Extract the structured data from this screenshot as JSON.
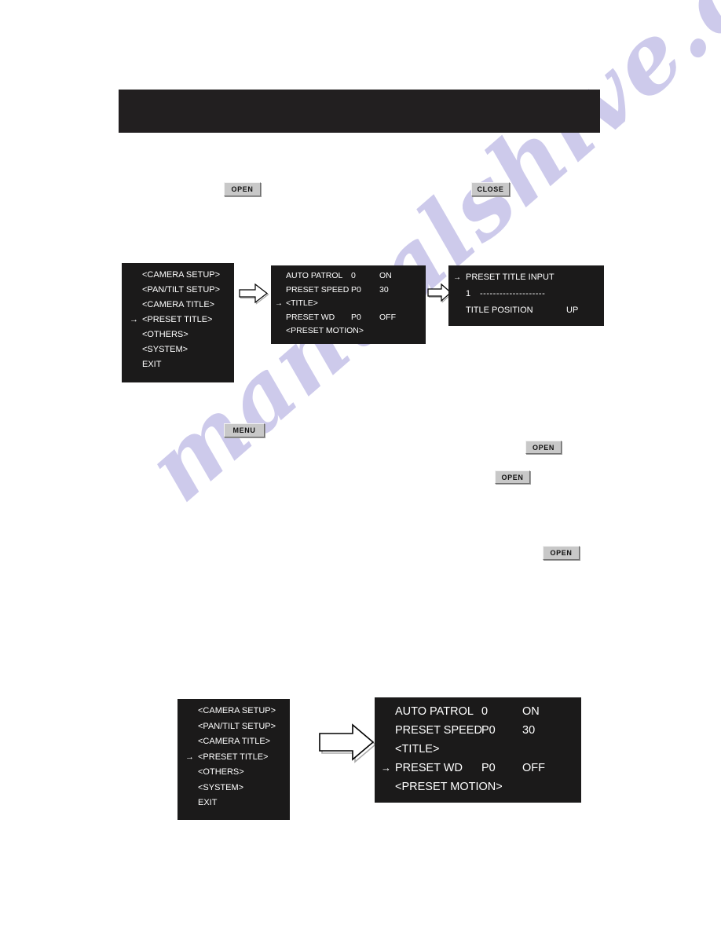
{
  "page": {
    "header_bar_text": "",
    "watermark": "manualshive.com"
  },
  "buttons": {
    "open": "OPEN",
    "close": "CLOSE",
    "menu": "MENU"
  },
  "icons": {
    "flow_arrow": "right-block-arrow-icon",
    "cursor": "→"
  },
  "menu_top": {
    "cursor_index": 3,
    "items": [
      {
        "label": "<CAMERA SETUP>"
      },
      {
        "label": "<PAN/TILT SETUP>"
      },
      {
        "label": "<CAMERA TITLE>"
      },
      {
        "label": "<PRESET TITLE>"
      },
      {
        "label": "<OTHERS>"
      },
      {
        "label": "<SYSTEM>"
      },
      {
        "label": "EXIT"
      }
    ]
  },
  "preset_top": {
    "cursor_index": 2,
    "rows": [
      {
        "label": "AUTO PATROL",
        "value1": "0",
        "value2": "ON"
      },
      {
        "label": "PRESET SPEED",
        "value1": "P0",
        "value2": "30"
      },
      {
        "label": "<TITLE>",
        "value1": "",
        "value2": ""
      },
      {
        "label": "PRESET WD",
        "value1": "P0",
        "value2": "OFF"
      },
      {
        "label": "<PRESET MOTION>",
        "value1": "",
        "value2": ""
      }
    ]
  },
  "title_input": {
    "cursor_index": 0,
    "heading": "PRESET TITLE INPUT",
    "entry_number": "1",
    "entry_dashes": "--------------------",
    "position_label": "TITLE POSITION",
    "position_value": "UP"
  },
  "menu_bottom": {
    "cursor_index": 3,
    "items": [
      {
        "label": "<CAMERA SETUP>"
      },
      {
        "label": "<PAN/TILT SETUP>"
      },
      {
        "label": "<CAMERA TITLE>"
      },
      {
        "label": "<PRESET TITLE>"
      },
      {
        "label": "<OTHERS>"
      },
      {
        "label": "<SYSTEM>"
      },
      {
        "label": "EXIT"
      }
    ]
  },
  "preset_bottom": {
    "cursor_index": 3,
    "rows": [
      {
        "label": "AUTO PATROL",
        "value1": "0",
        "value2": "ON"
      },
      {
        "label": "PRESET SPEED",
        "value1": "P0",
        "value2": "30"
      },
      {
        "label": "<TITLE>",
        "value1": "",
        "value2": ""
      },
      {
        "label": "PRESET WD",
        "value1": "P0",
        "value2": "OFF"
      },
      {
        "label": "<PRESET MOTION>",
        "value1": "",
        "value2": ""
      }
    ]
  },
  "colors": {
    "osd_background": "#1b1a1a",
    "header_bar": "#221f20",
    "button_face": "#c8c8c8",
    "watermark": "#c9c6ea"
  }
}
